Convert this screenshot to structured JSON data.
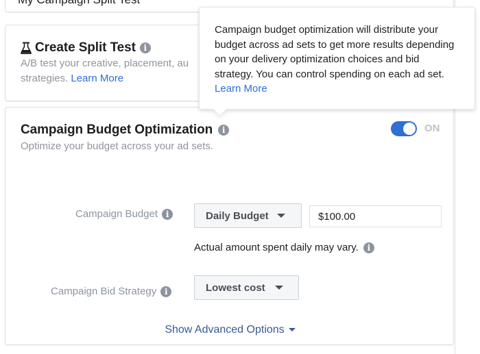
{
  "campaign_name": {
    "value": "My Campaign Split Test"
  },
  "split_test": {
    "title": "Create Split Test",
    "icon": "flask-icon",
    "description": "A/B test your creative, placement, au",
    "description_line2": "strategies.",
    "learn_more": "Learn More"
  },
  "cbo": {
    "title": "Campaign Budget Optimization",
    "description": "Optimize your budget across your ad sets.",
    "toggle": {
      "state": "on",
      "label": "ON",
      "color": "#2f6fd6"
    },
    "budget": {
      "label": "Campaign Budget",
      "type_selected": "Daily Budget",
      "amount": "$100.00",
      "note": "Actual amount spent daily may vary."
    },
    "bid_strategy": {
      "label": "Campaign Bid Strategy",
      "selected": "Lowest cost"
    },
    "advanced_options": "Show Advanced Options"
  },
  "tooltip": {
    "text": "Campaign budget optimization will distribute your budget across ad sets to get more results depending on your delivery optimization choices and bid strategy. You can control spending on each ad set.",
    "learn_more": "Learn More"
  },
  "icons": {
    "info": "i"
  }
}
